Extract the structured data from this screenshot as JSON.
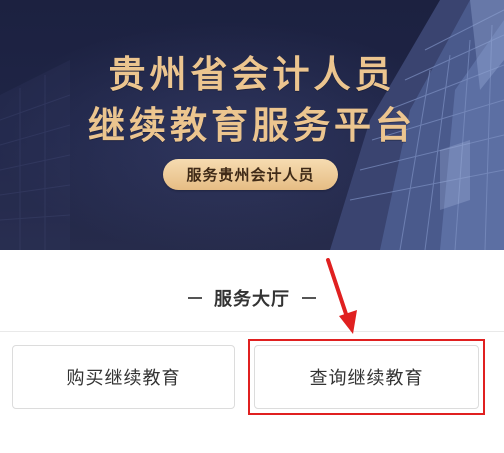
{
  "banner": {
    "title_line1": "贵州省会计人员",
    "title_line2": "继续教育服务平台",
    "pill_label": "服务贵州会计人员"
  },
  "service_hall": {
    "title": "服务大厅",
    "buttons": [
      {
        "label": "购买继续教育"
      },
      {
        "label": "查询继续教育"
      }
    ]
  },
  "colors": {
    "banner_bg": "#1f2547",
    "title_gold": "#ecc58f",
    "pill_bg": "#e6bd84",
    "annotation_red": "#e02020"
  },
  "icons": {
    "annotation_arrow": "red-arrow-pointing-down"
  }
}
